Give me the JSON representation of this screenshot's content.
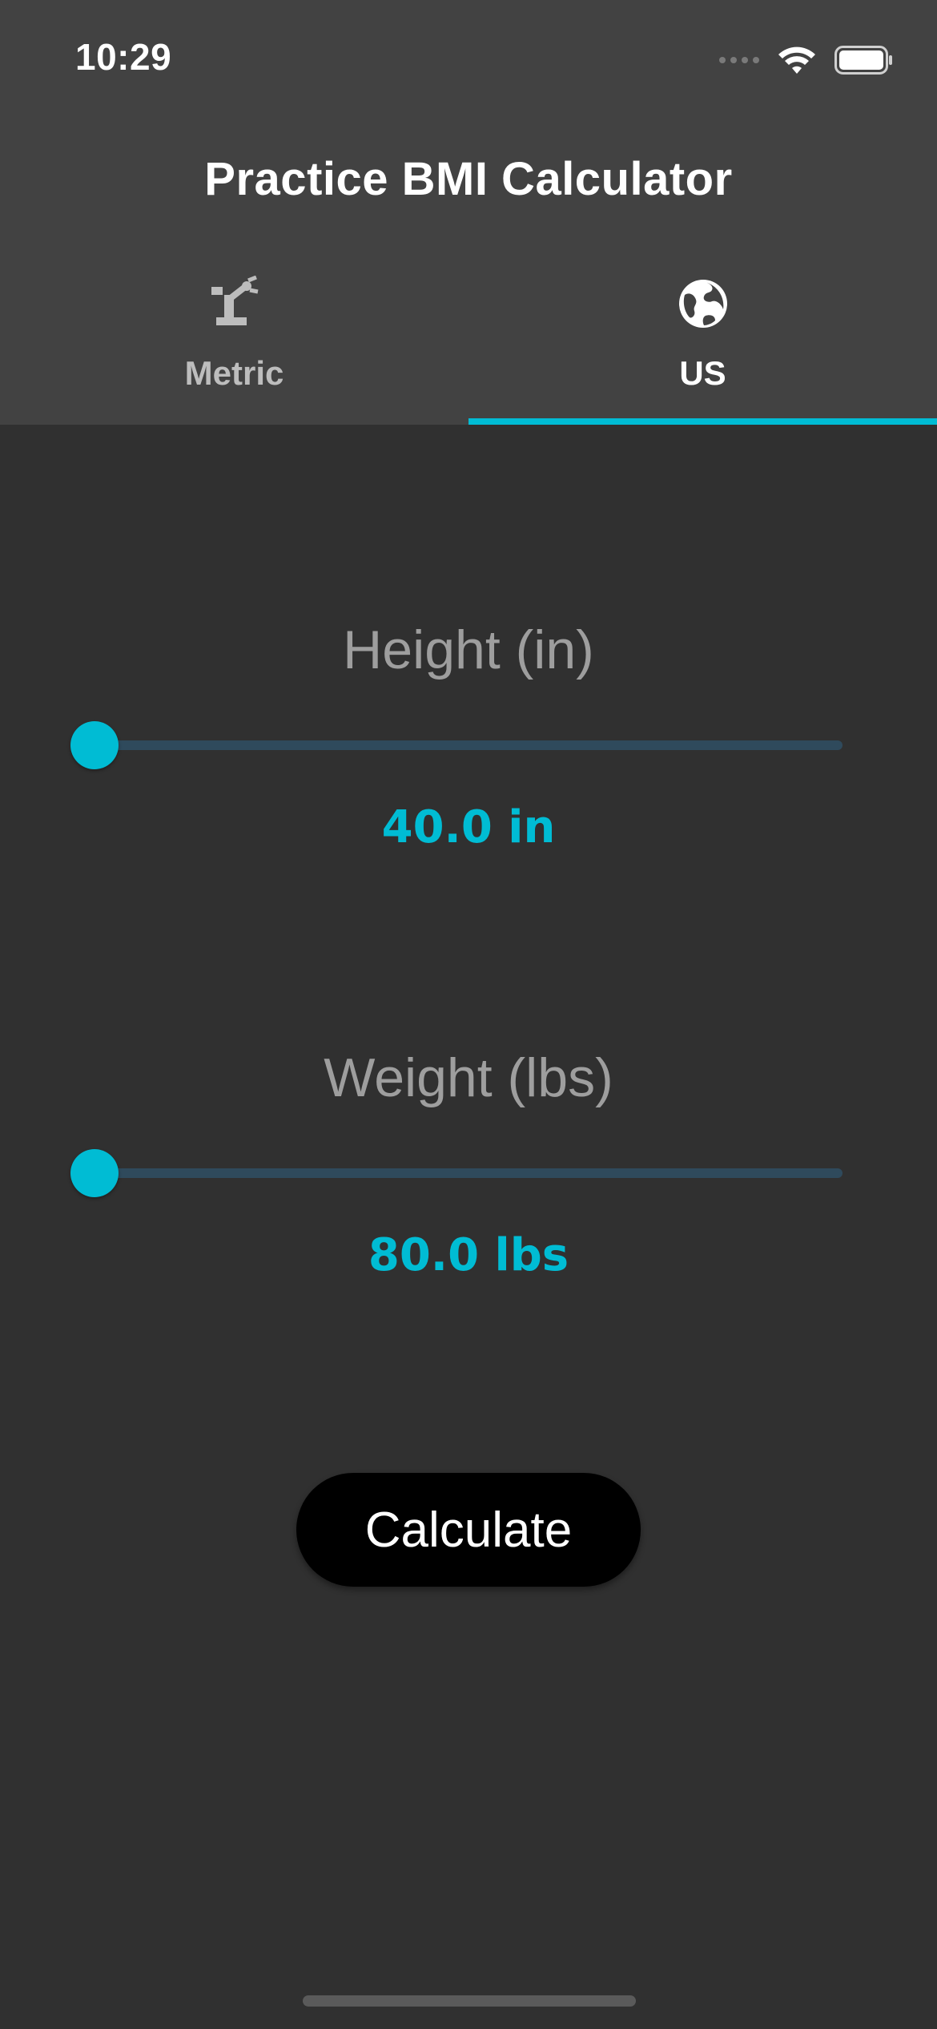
{
  "status_bar": {
    "time": "10:29",
    "wifi_icon": "wifi-icon",
    "battery_icon": "battery-icon",
    "signal_icon": "cellular-signal-icon"
  },
  "app_bar": {
    "title": "Practice BMI Calculator"
  },
  "tabs": [
    {
      "label": "Metric",
      "icon": "robot-arm-icon",
      "selected": false
    },
    {
      "label": "US",
      "icon": "globe-icon",
      "selected": true
    }
  ],
  "height": {
    "label": "Height (in)",
    "value_text": "40.0 in",
    "slider_fraction": 0
  },
  "weight": {
    "label": "Weight (lbs)",
    "value_text": "80.0 lbs",
    "slider_fraction": 0
  },
  "calculate_button": {
    "label": "Calculate"
  },
  "colors": {
    "accent": "#00bcd4",
    "app_bar_bg": "#424242",
    "body_bg": "#303030",
    "slider_track": "#2f4a5c",
    "button_bg": "#000000"
  }
}
